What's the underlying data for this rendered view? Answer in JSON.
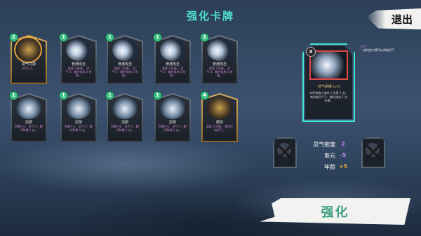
{
  "header": {
    "title": "强化卡牌",
    "exit_label": "退出"
  },
  "cards": [
    {
      "level": "2",
      "name": "剑气共振",
      "desc": "灵气+1。",
      "art": "hero-gold",
      "selected": true
    },
    {
      "level": "1",
      "name": "普通攻击",
      "desc": "造成 3 伤害。\n灵气-1：额外造成 1 伤害。",
      "art": "slash"
    },
    {
      "level": "1",
      "name": "普通攻击",
      "desc": "造成 3 伤害。\n灵气-1：额外造成 1 伤害。",
      "art": "slash"
    },
    {
      "level": "1",
      "name": "普通攻击",
      "desc": "造成 3 伤害。\n灵气-1：额外造成 1 伤害。",
      "art": "slash"
    },
    {
      "level": "1",
      "name": "普通攻击",
      "desc": "造成 3 伤害。\n灵气-1：额外造成 1 伤害。",
      "art": "slash"
    },
    {
      "level": "1",
      "name": "招架",
      "desc": "防御+3。\n灵气-1：额外防御 1 点。",
      "art": "warrior"
    },
    {
      "level": "1",
      "name": "招架",
      "desc": "防御+3。\n灵气-1：额外防御 1 点。",
      "art": "warrior"
    },
    {
      "level": "1",
      "name": "招架",
      "desc": "防御+3。\n灵气-1：额外防御 1 点。",
      "art": "warrior"
    },
    {
      "level": "1",
      "name": "招架",
      "desc": "防御+3。\n灵气-1：额外防御 1 点。",
      "art": "warrior"
    },
    {
      "level": "4",
      "name": "磨剑",
      "desc": "造成 1 伤害。\n使用后加灵气。",
      "art": "hero-gold",
      "gold_frame": true
    }
  ],
  "detail": {
    "close_label": "X",
    "name": "剑气纵横 Lv.2",
    "desc": "对所有敌人造成 1 伤害 2 次。\n每消耗灵气-1：额外造成 1 次伤害。"
  },
  "tooltip": {
    "keyword": "灵气",
    "text": "一些特定卡牌可以消耗灵气"
  },
  "stats": [
    {
      "label": "灵气密度",
      "value": "2",
      "color": "#b77ff0"
    },
    {
      "label": "寿元",
      "value": "-5",
      "color": "#b77ff0"
    },
    {
      "label": "年龄",
      "value": "+5",
      "color": "#e3a63a"
    }
  ],
  "forge": {
    "label": "强化"
  }
}
